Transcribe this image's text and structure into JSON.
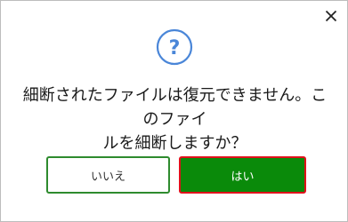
{
  "dialog": {
    "message_line1": "細断されたファイルは復元できません。このファイ",
    "message_line2": "ルを細断しますか？",
    "no_label": "いいえ",
    "yes_label": "はい"
  },
  "icons": {
    "close": "close-icon",
    "help": "question-circle-icon"
  },
  "colors": {
    "accent_blue": "#4a86d8",
    "yes_button_bg": "#0a8a0a",
    "yes_button_focus_border": "#e0101a",
    "no_button_border": "#2e8b2e"
  }
}
